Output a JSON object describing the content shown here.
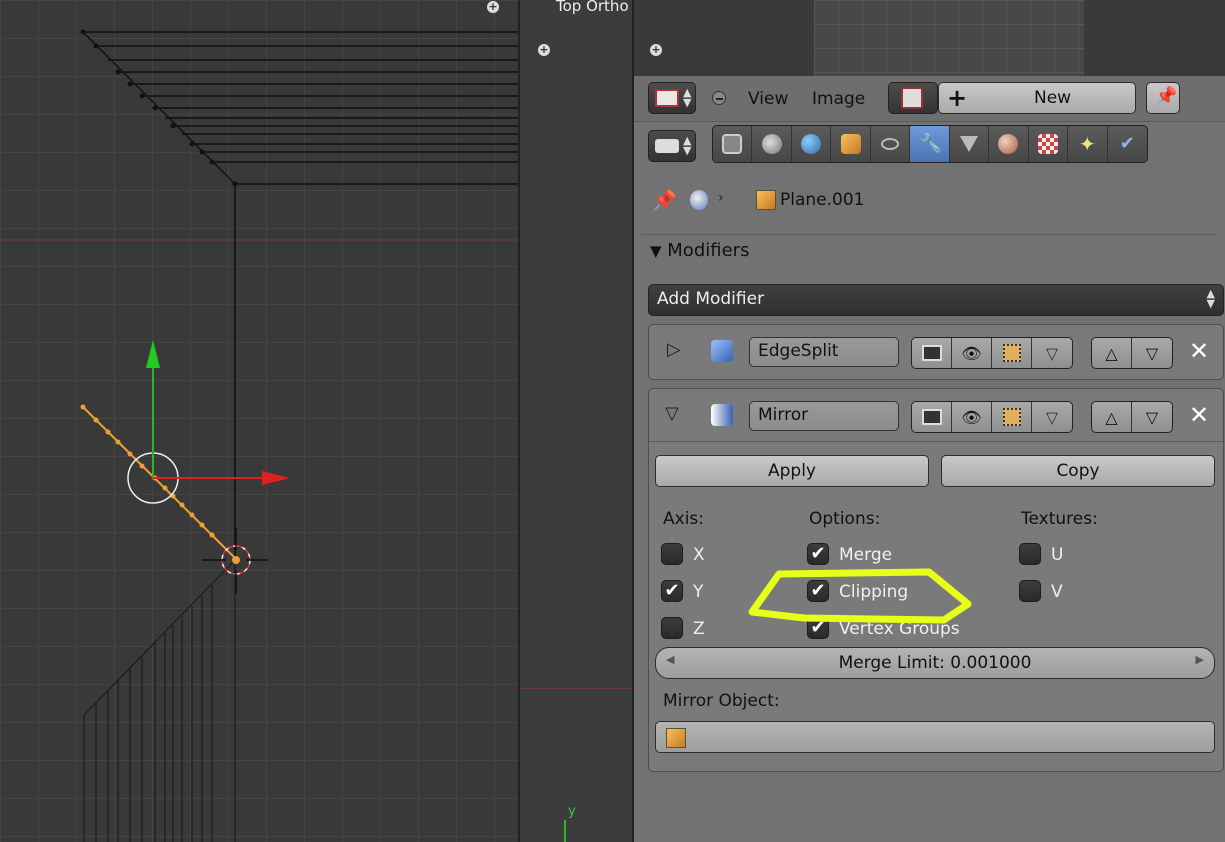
{
  "viewport": {
    "overlay_text": "Top Ortho",
    "small_axis_label": "y"
  },
  "header": {
    "menu_view": "View",
    "menu_image": "Image",
    "new_label": "New"
  },
  "breadcrumb": {
    "object_name": "Plane.001"
  },
  "modifiers": {
    "section_title": "Modifiers",
    "add_modifier_label": "Add Modifier",
    "edgesplit": {
      "name": "EdgeSplit"
    },
    "mirror": {
      "name": "Mirror",
      "apply_label": "Apply",
      "copy_label": "Copy",
      "axis_label": "Axis:",
      "options_label": "Options:",
      "textures_label": "Textures:",
      "axis": [
        {
          "label": "X",
          "checked": false
        },
        {
          "label": "Y",
          "checked": true
        },
        {
          "label": "Z",
          "checked": false
        }
      ],
      "options": [
        {
          "label": "Merge",
          "checked": true
        },
        {
          "label": "Clipping",
          "checked": true
        },
        {
          "label": "Vertex Groups",
          "checked": true
        }
      ],
      "textures": [
        {
          "label": "U",
          "checked": false
        },
        {
          "label": "V",
          "checked": false
        }
      ],
      "merge_limit_label": "Merge Limit: 0.001000",
      "mirror_object_label": "Mirror Object:"
    }
  },
  "colors": {
    "highlight": "#e8ff1a",
    "active_tab": "#5a84c6",
    "mesh_orange": "#f0a030"
  }
}
